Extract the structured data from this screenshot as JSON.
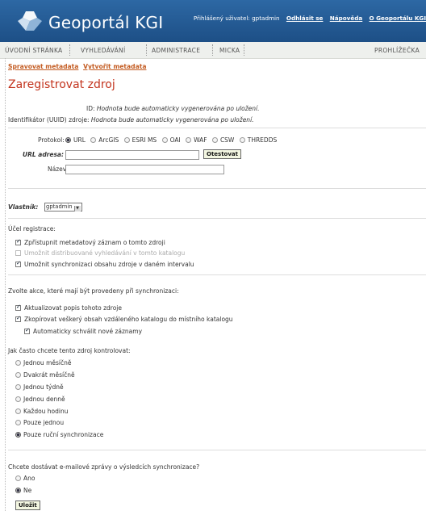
{
  "header": {
    "app_title": "Geoportál KGI",
    "user_text": "Přihlášený uživatel: gptadmin",
    "logout": "Odhlásit se",
    "help": "Nápověda",
    "about": "O Geoportálu KGI"
  },
  "nav": {
    "items": [
      "ÚVODNÍ STRÁNKA",
      "VYHLEDÁVÁNÍ",
      "ADMINISTRACE",
      "MICKA"
    ],
    "right": "PROHLÍŽEČKA"
  },
  "submenu": {
    "manage": "Spravovat metadata",
    "create": "Vytvořit metadata"
  },
  "page_title": "Zaregistrovat zdroj",
  "ids": {
    "id_label": "ID:",
    "id_value": "Hodnota bude automaticky vygenerována po uložení.",
    "uuid_label": "Identifikátor (UUID) zdroje:",
    "uuid_value": "Hodnota bude automaticky vygenerována po uložení."
  },
  "protocol": {
    "label": "Protokol:",
    "options": [
      "URL",
      "ArcGIS",
      "ESRI MS",
      "OAI",
      "WAF",
      "CSW",
      "THREDDS"
    ],
    "selected": "URL"
  },
  "url": {
    "label": "URL adresa:",
    "value": "",
    "test_button": "Otestovat"
  },
  "name": {
    "label": "Název:",
    "value": ""
  },
  "owner": {
    "label": "Vlastník:",
    "selected": "gptadmin"
  },
  "purpose": {
    "title": "Účel registrace:",
    "items": [
      {
        "label": "Zpřístupnit metadatový záznam o tomto zdroji",
        "checked": true,
        "disabled": false
      },
      {
        "label": "Umožnit distribuované vyhledávání v tomto katalogu",
        "checked": false,
        "disabled": true
      },
      {
        "label": "Umožnit synchronizaci obsahu zdroje v daném intervalu",
        "checked": true,
        "disabled": false
      }
    ]
  },
  "actions": {
    "title": "Zvolte akce, které mají být provedeny při synchronizaci:",
    "items": [
      {
        "label": "Aktualizovat popis tohoto zdroje",
        "checked": true
      },
      {
        "label": "Zkopírovat veškerý obsah vzdáleného katalogu do místního katalogu",
        "checked": true
      },
      {
        "label": "Automaticky schválit nové záznamy",
        "checked": true
      }
    ]
  },
  "frequency": {
    "title": "Jak často chcete tento zdroj kontrolovat:",
    "options": [
      "Jednou měsíčně",
      "Dvakrát měsíčně",
      "Jednou týdně",
      "Jednou denně",
      "Každou hodinu",
      "Pouze jednou",
      "Pouze ruční synchronizace"
    ],
    "selected": "Pouze ruční synchronizace"
  },
  "email": {
    "title": "Chcete dostávat e-mailové zprávy o výsledcích synchronizace?",
    "options": [
      "Ano",
      "Ne"
    ],
    "selected": "Ne"
  },
  "save_button": "Uložit"
}
